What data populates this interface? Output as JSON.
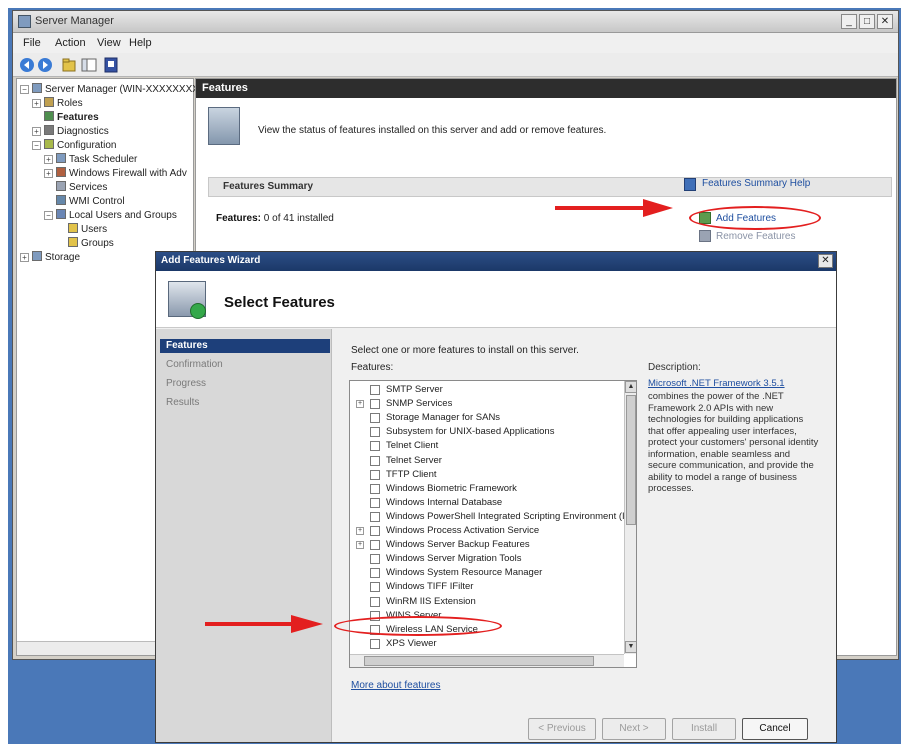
{
  "window": {
    "title": "Server Manager",
    "controls": {
      "minimize": "_",
      "maximize": "□",
      "close": "✕"
    }
  },
  "menu": [
    "File",
    "Action",
    "View",
    "Help"
  ],
  "toolbar_icons": [
    "back-icon",
    "forward-icon",
    "up-icon",
    "show-hide-tree-icon",
    "help-icon"
  ],
  "tree": {
    "items": [
      {
        "label": "Server Manager (WIN-XXXXXXXX)",
        "level": 0,
        "expander": "−",
        "icon": "server-icon"
      },
      {
        "label": "Roles",
        "level": 1,
        "expander": "+",
        "icon": "roles-icon"
      },
      {
        "label": "Features",
        "level": 1,
        "expander": "",
        "icon": "features-icon",
        "selected": true
      },
      {
        "label": "Diagnostics",
        "level": 1,
        "expander": "+",
        "icon": "diagnostics-icon"
      },
      {
        "label": "Configuration",
        "level": 1,
        "expander": "−",
        "icon": "configuration-icon"
      },
      {
        "label": "Task Scheduler",
        "level": 2,
        "expander": "+",
        "icon": "task-scheduler-icon"
      },
      {
        "label": "Windows Firewall with Adv",
        "level": 2,
        "expander": "+",
        "icon": "firewall-icon"
      },
      {
        "label": "Services",
        "level": 2,
        "expander": "",
        "icon": "services-icon"
      },
      {
        "label": "WMI Control",
        "level": 2,
        "expander": "",
        "icon": "wmi-icon"
      },
      {
        "label": "Local Users and Groups",
        "level": 2,
        "expander": "−",
        "icon": "users-groups-icon"
      },
      {
        "label": "Users",
        "level": 3,
        "expander": "",
        "icon": "folder-icon"
      },
      {
        "label": "Groups",
        "level": 3,
        "expander": "",
        "icon": "folder-icon"
      },
      {
        "label": "Storage",
        "level": 0,
        "expander": "+",
        "icon": "storage-icon"
      }
    ]
  },
  "content": {
    "header": "Features",
    "intro": "View the status of features installed on this server and add or remove features.",
    "section_title": "Features Summary",
    "help_link": "Features Summary Help",
    "features_label": "Features:",
    "features_status": "0 of 41 installed",
    "add_link": "Add Features",
    "remove_link": "Remove Features"
  },
  "wizard": {
    "title": "Add Features Wizard",
    "close": "✕",
    "header": "Select Features",
    "steps": [
      {
        "label": "Features",
        "active": true
      },
      {
        "label": "Confirmation",
        "active": false
      },
      {
        "label": "Progress",
        "active": false
      },
      {
        "label": "Results",
        "active": false
      }
    ],
    "instructions": "Select one or more features to install on this server.",
    "features_label": "Features:",
    "features": [
      {
        "label": "SMTP Server",
        "expander": false
      },
      {
        "label": "SNMP Services",
        "expander": true
      },
      {
        "label": "Storage Manager for SANs",
        "expander": false
      },
      {
        "label": "Subsystem for UNIX-based Applications",
        "expander": false
      },
      {
        "label": "Telnet Client",
        "expander": false
      },
      {
        "label": "Telnet Server",
        "expander": false
      },
      {
        "label": "TFTP Client",
        "expander": false
      },
      {
        "label": "Windows Biometric Framework",
        "expander": false
      },
      {
        "label": "Windows Internal Database",
        "expander": false
      },
      {
        "label": "Windows PowerShell Integrated Scripting Environment (IS",
        "expander": false
      },
      {
        "label": "Windows Process Activation Service",
        "expander": true
      },
      {
        "label": "Windows Server Backup Features",
        "expander": true
      },
      {
        "label": "Windows Server Migration Tools",
        "expander": false
      },
      {
        "label": "Windows System Resource Manager",
        "expander": false
      },
      {
        "label": "Windows TIFF IFilter",
        "expander": false
      },
      {
        "label": "WinRM IIS Extension",
        "expander": false
      },
      {
        "label": "WINS Server",
        "expander": false
      },
      {
        "label": "Wireless LAN Service",
        "expander": false
      },
      {
        "label": "XPS Viewer",
        "expander": false
      }
    ],
    "more_link": "More about features",
    "description_label": "Description:",
    "description_link": "Microsoft .NET Framework 3.5.1",
    "description_text": "combines the power of the .NET Framework 2.0 APIs with new technologies for building applications that offer appealing user interfaces, protect your customers' personal identity information, enable seamless and secure communication, and provide the ability to model a range of business processes.",
    "buttons": {
      "previous": "< Previous",
      "next": "Next >",
      "install": "Install",
      "cancel": "Cancel"
    }
  },
  "annotations": {
    "arrow_color": "#e31f1f"
  }
}
